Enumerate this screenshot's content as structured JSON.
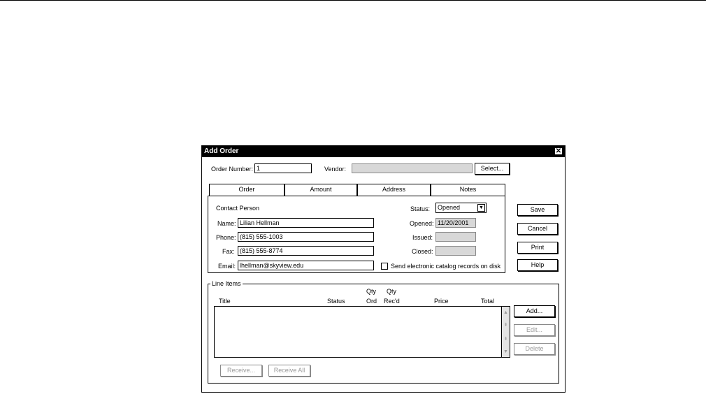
{
  "dialog": {
    "title": "Add Order",
    "close_glyph": "✕",
    "order_number_label": "Order Number:",
    "order_number_value": "1",
    "vendor_label": "Vendor:",
    "vendor_value": "",
    "select_button": "Select..."
  },
  "tabs": [
    {
      "label": "Order"
    },
    {
      "label": "Amount"
    },
    {
      "label": "Address"
    },
    {
      "label": "Notes"
    }
  ],
  "order_tab": {
    "contact_person_label": "Contact Person",
    "name_label": "Name:",
    "name_value": "Lilian Hellman",
    "phone_label": "Phone:",
    "phone_value": "(815) 555-1003",
    "fax_label": "Fax:",
    "fax_value": "(815) 555-8774",
    "email_label": "Email:",
    "email_value": "lhellman@skyview.edu",
    "status_label": "Status:",
    "status_value": "Opened",
    "opened_label": "Opened:",
    "opened_value": "11/20/2001",
    "issued_label": "Issued:",
    "issued_value": "",
    "closed_label": "Closed:",
    "closed_value": "",
    "send_electronic_label": "Send electronic catalog records on disk"
  },
  "side_buttons": {
    "save": "Save",
    "cancel": "Cancel",
    "print": "Print",
    "help": "Help"
  },
  "line_items": {
    "group_label": "Line Items",
    "columns": {
      "title": "Title",
      "status": "Status",
      "qty_ord_top": "Qty",
      "qty_ord_bottom": "Ord",
      "qty_recd_top": "Qty",
      "qty_recd_bottom": "Rec'd",
      "price": "Price",
      "total": "Total"
    },
    "rows": [],
    "add_button": "Add...",
    "edit_button": "Edit...",
    "delete_button": "Delete",
    "receive_button": "Receive...",
    "receive_all_button": "Receive All"
  },
  "icons": {
    "dropdown": "chevron-down-icon",
    "scroll_up": "arrow-up-icon",
    "scroll_top": "arrow-first-icon",
    "scroll_bottom": "arrow-last-icon",
    "scroll_down": "arrow-down-icon"
  },
  "colors": {
    "titlebar": "#000000",
    "disabled_field": "#d8d8d8",
    "disabled_text": "#9a9a9a"
  }
}
